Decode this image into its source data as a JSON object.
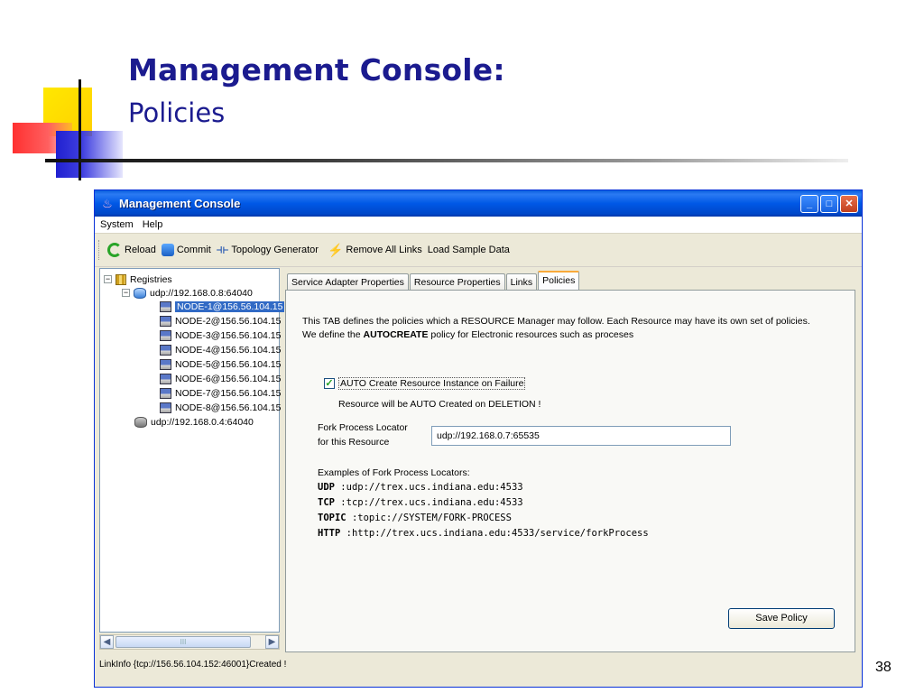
{
  "slide": {
    "title": "Management Console:",
    "subtitle": "Policies",
    "page_number": "38"
  },
  "window": {
    "title": "Management Console",
    "title_icon": "java-cup-icon",
    "controls": [
      "minimize",
      "maximize",
      "close"
    ]
  },
  "menu": [
    "System",
    "Help"
  ],
  "toolbar": {
    "reload": "Reload",
    "commit": "Commit",
    "topology": "Topology Generator",
    "remove_links": "Remove All Links",
    "load_sample": "Load Sample Data"
  },
  "tree": {
    "root": "Registries",
    "registry1": "udp://192.168.0.8:64040",
    "nodes": [
      "NODE-1@156.56.104.15",
      "NODE-2@156.56.104.15",
      "NODE-3@156.56.104.15",
      "NODE-4@156.56.104.15",
      "NODE-5@156.56.104.15",
      "NODE-6@156.56.104.15",
      "NODE-7@156.56.104.15",
      "NODE-8@156.56.104.15"
    ],
    "selected_index": 0,
    "registry2": "udp://192.168.0.4:64040"
  },
  "tabs": [
    "Service Adapter Properties",
    "Resource Properties",
    "Links",
    "Policies"
  ],
  "active_tab": "Policies",
  "policies": {
    "intro_line1": "This TAB defines the policies which a RESOURCE Manager may follow. Each Resource may have its own set of policies.",
    "intro_line2_prefix": "We define the ",
    "intro_line2_bold": "AUTOCREATE",
    "intro_line2_suffix": " policy for Electronic resources such as proceses",
    "checkbox_label": "AUTO Create Resource Instance on Failure",
    "checkbox_checked": true,
    "deletion_note": "Resource will be AUTO Created on DELETION !",
    "locator_label_1": "Fork Process Locator",
    "locator_label_2": "for this Resource",
    "locator_value": "udp://192.168.0.7:65535",
    "examples_heading": "Examples of Fork Process Locators:",
    "examples": [
      {
        "key": "UDP",
        "value": ":udp://trex.ucs.indiana.edu:4533"
      },
      {
        "key": "TCP",
        "value": ":tcp://trex.ucs.indiana.edu:4533"
      },
      {
        "key": "TOPIC",
        "value": ":topic://SYSTEM/FORK-PROCESS"
      },
      {
        "key": "HTTP",
        "value": ":http://trex.ucs.indiana.edu:4533/service/forkProcess"
      }
    ],
    "save_button": "Save Policy"
  },
  "status_text": "LinkInfo {tcp://156.56.104.152:46001}Created !",
  "scrollbar_thumb_text": "III"
}
